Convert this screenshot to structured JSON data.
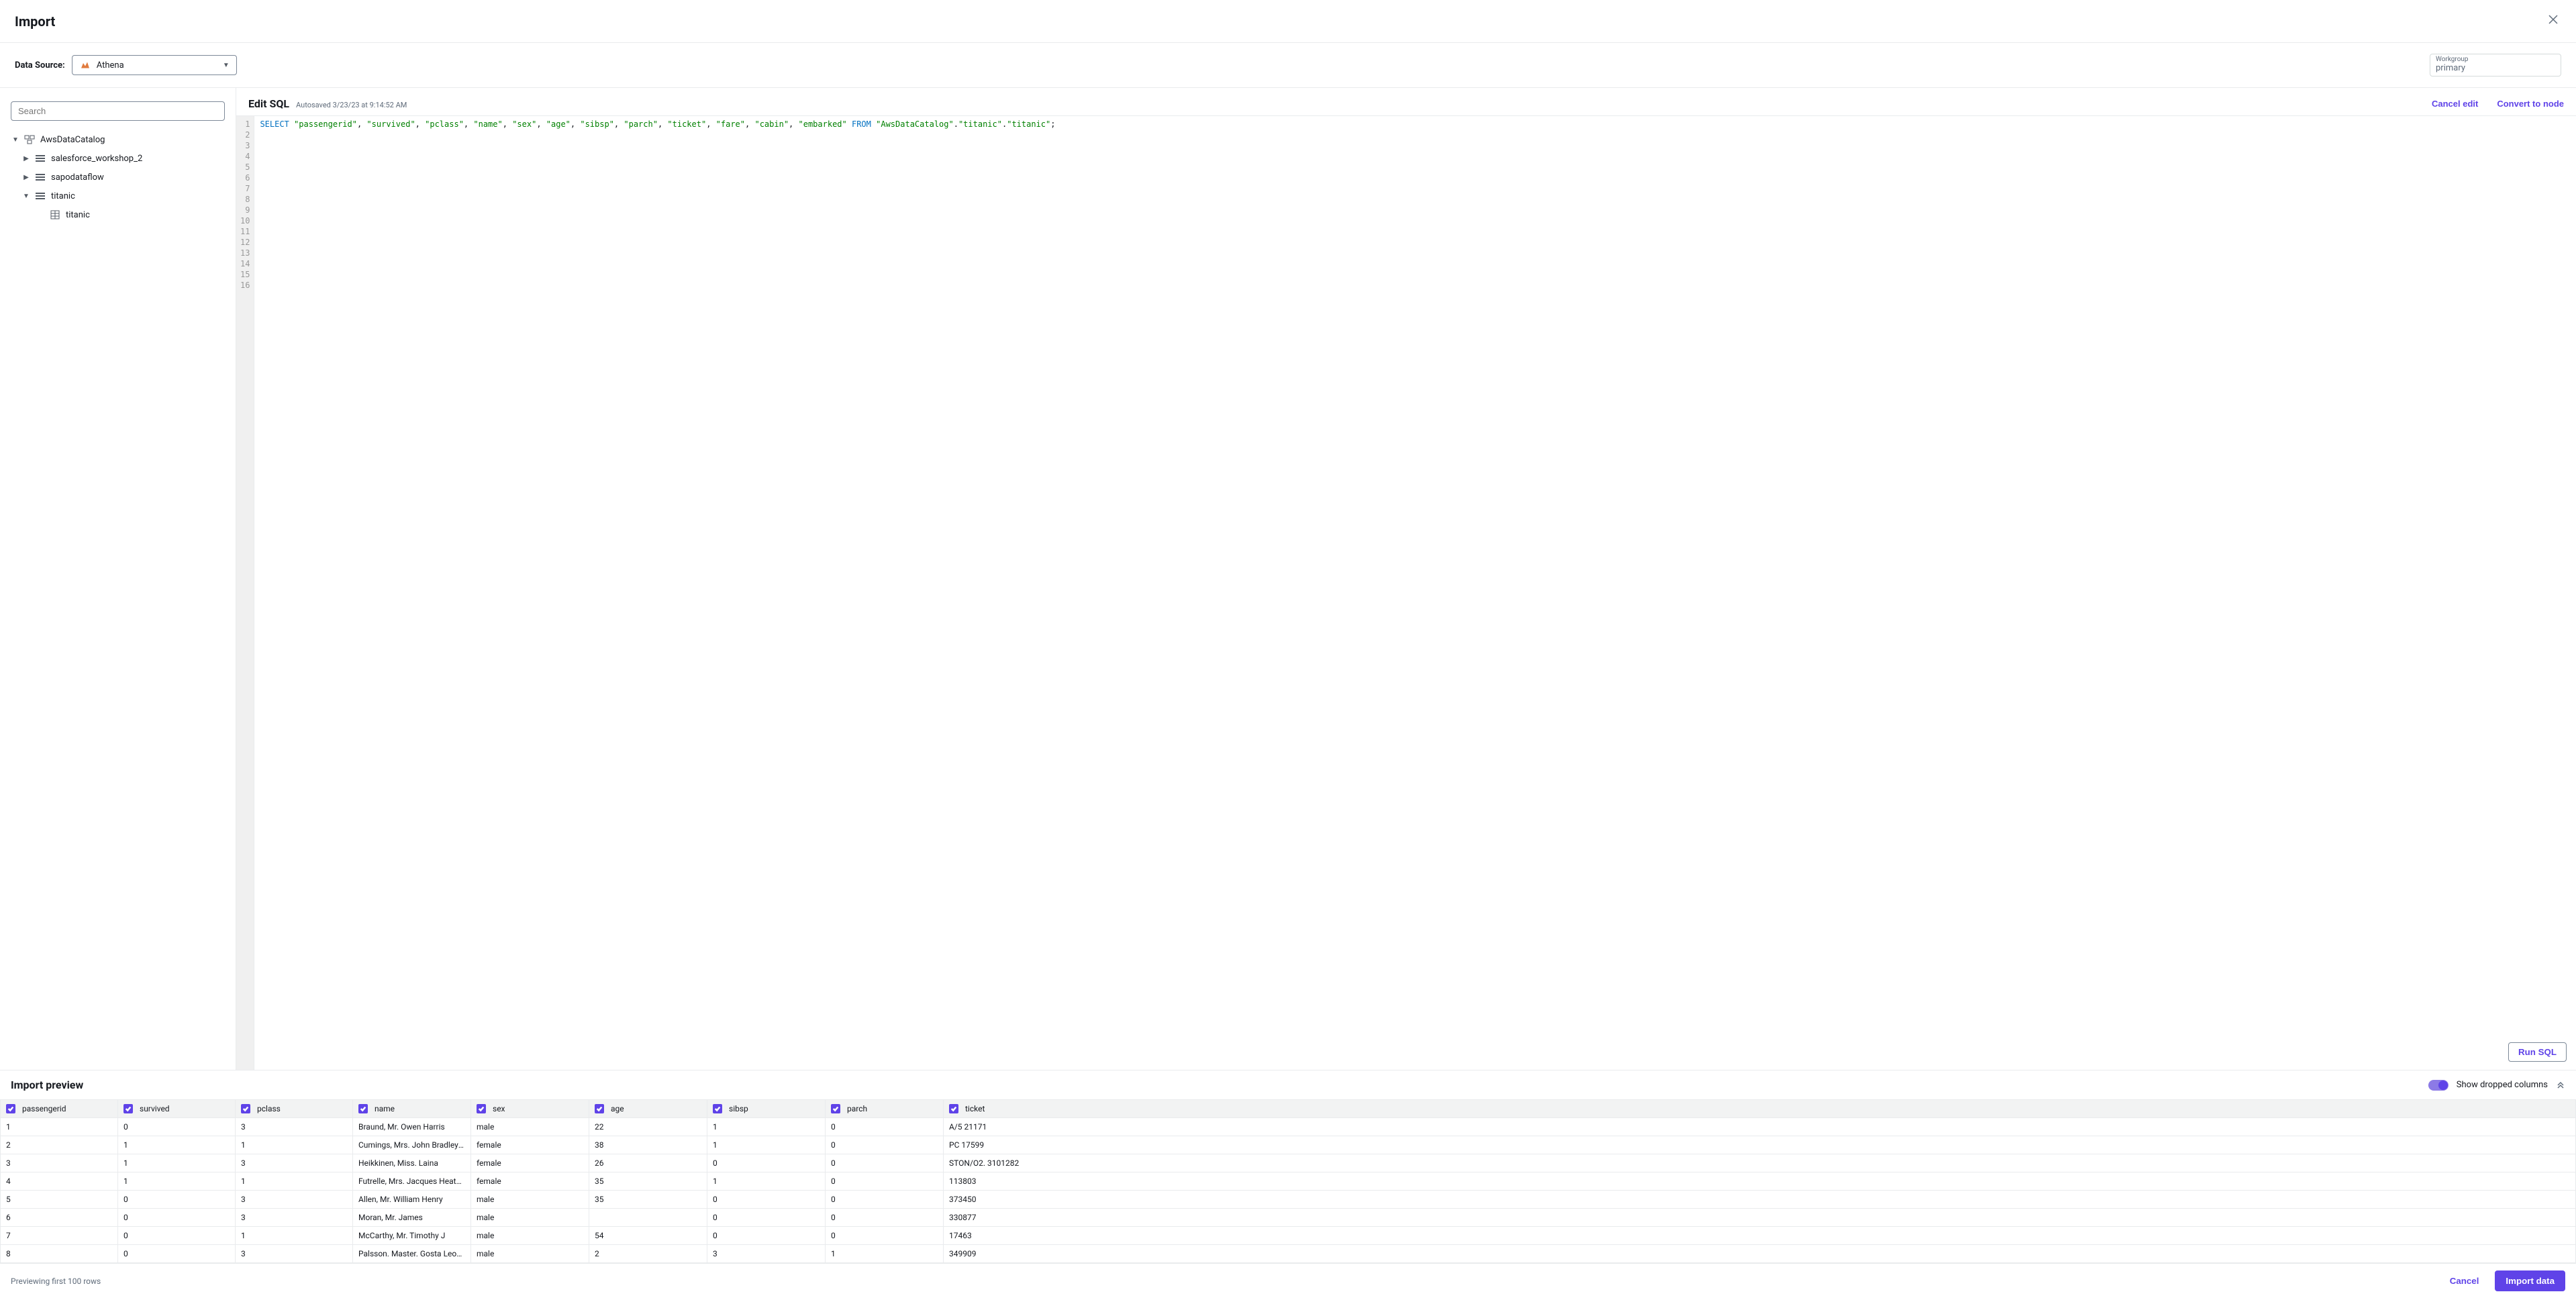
{
  "header": {
    "title": "Import"
  },
  "datasource": {
    "label": "Data Source:",
    "selected": "Athena"
  },
  "workgroup": {
    "label": "Workgroup",
    "value": "primary"
  },
  "sidebar": {
    "search_placeholder": "Search",
    "catalog": "AwsDataCatalog",
    "databases": [
      {
        "name": "salesforce_workshop_2",
        "expanded": false
      },
      {
        "name": "sapodataflow",
        "expanded": false
      },
      {
        "name": "titanic",
        "expanded": true,
        "tables": [
          "titanic"
        ]
      }
    ]
  },
  "editor": {
    "title": "Edit SQL",
    "autosave": "Autosaved 3/23/23 at 9:14:52 AM",
    "cancel_label": "Cancel edit",
    "convert_label": "Convert to node",
    "run_label": "Run SQL",
    "sql_tokens": [
      {
        "t": "kw",
        "v": "SELECT"
      },
      {
        "t": "sp",
        "v": " "
      },
      {
        "t": "str",
        "v": "\"passengerid\""
      },
      {
        "t": "p",
        "v": ", "
      },
      {
        "t": "str",
        "v": "\"survived\""
      },
      {
        "t": "p",
        "v": ", "
      },
      {
        "t": "str",
        "v": "\"pclass\""
      },
      {
        "t": "p",
        "v": ", "
      },
      {
        "t": "str",
        "v": "\"name\""
      },
      {
        "t": "p",
        "v": ", "
      },
      {
        "t": "str",
        "v": "\"sex\""
      },
      {
        "t": "p",
        "v": ", "
      },
      {
        "t": "str",
        "v": "\"age\""
      },
      {
        "t": "p",
        "v": ", "
      },
      {
        "t": "str",
        "v": "\"sibsp\""
      },
      {
        "t": "p",
        "v": ", "
      },
      {
        "t": "str",
        "v": "\"parch\""
      },
      {
        "t": "p",
        "v": ", "
      },
      {
        "t": "str",
        "v": "\"ticket\""
      },
      {
        "t": "p",
        "v": ", "
      },
      {
        "t": "str",
        "v": "\"fare\""
      },
      {
        "t": "p",
        "v": ", "
      },
      {
        "t": "str",
        "v": "\"cabin\""
      },
      {
        "t": "p",
        "v": ", "
      },
      {
        "t": "str",
        "v": "\"embarked\""
      },
      {
        "t": "sp",
        "v": " "
      },
      {
        "t": "kw",
        "v": "FROM"
      },
      {
        "t": "sp",
        "v": " "
      },
      {
        "t": "str",
        "v": "\"AwsDataCatalog\""
      },
      {
        "t": "p",
        "v": "."
      },
      {
        "t": "str",
        "v": "\"titanic\""
      },
      {
        "t": "p",
        "v": "."
      },
      {
        "t": "str",
        "v": "\"titanic\""
      },
      {
        "t": "p",
        "v": ";"
      }
    ],
    "line_count": 16
  },
  "preview": {
    "title": "Import preview",
    "toggle_label": "Show dropped columns",
    "columns": [
      "passengerid",
      "survived",
      "pclass",
      "name",
      "sex",
      "age",
      "sibsp",
      "parch",
      "ticket"
    ],
    "rows": [
      [
        "1",
        "0",
        "3",
        "Braund, Mr. Owen Harris",
        "male",
        "22",
        "1",
        "0",
        "A/5 21171"
      ],
      [
        "2",
        "1",
        "1",
        "Cumings, Mrs. John Bradley (Florenc",
        "female",
        "38",
        "1",
        "0",
        "PC 17599"
      ],
      [
        "3",
        "1",
        "3",
        "Heikkinen, Miss. Laina",
        "female",
        "26",
        "0",
        "0",
        "STON/O2. 3101282"
      ],
      [
        "4",
        "1",
        "1",
        "Futrelle, Mrs. Jacques Heath (Lily Ma",
        "female",
        "35",
        "1",
        "0",
        "113803"
      ],
      [
        "5",
        "0",
        "3",
        "Allen, Mr. William Henry",
        "male",
        "35",
        "0",
        "0",
        "373450"
      ],
      [
        "6",
        "0",
        "3",
        "Moran, Mr. James",
        "male",
        "",
        "0",
        "0",
        "330877"
      ],
      [
        "7",
        "0",
        "1",
        "McCarthy, Mr. Timothy J",
        "male",
        "54",
        "0",
        "0",
        "17463"
      ],
      [
        "8",
        "0",
        "3",
        "Palsson. Master. Gosta Leonard",
        "male",
        "2",
        "3",
        "1",
        "349909"
      ]
    ]
  },
  "footer": {
    "status": "Previewing first 100 rows",
    "cancel_label": "Cancel",
    "import_label": "Import data"
  }
}
